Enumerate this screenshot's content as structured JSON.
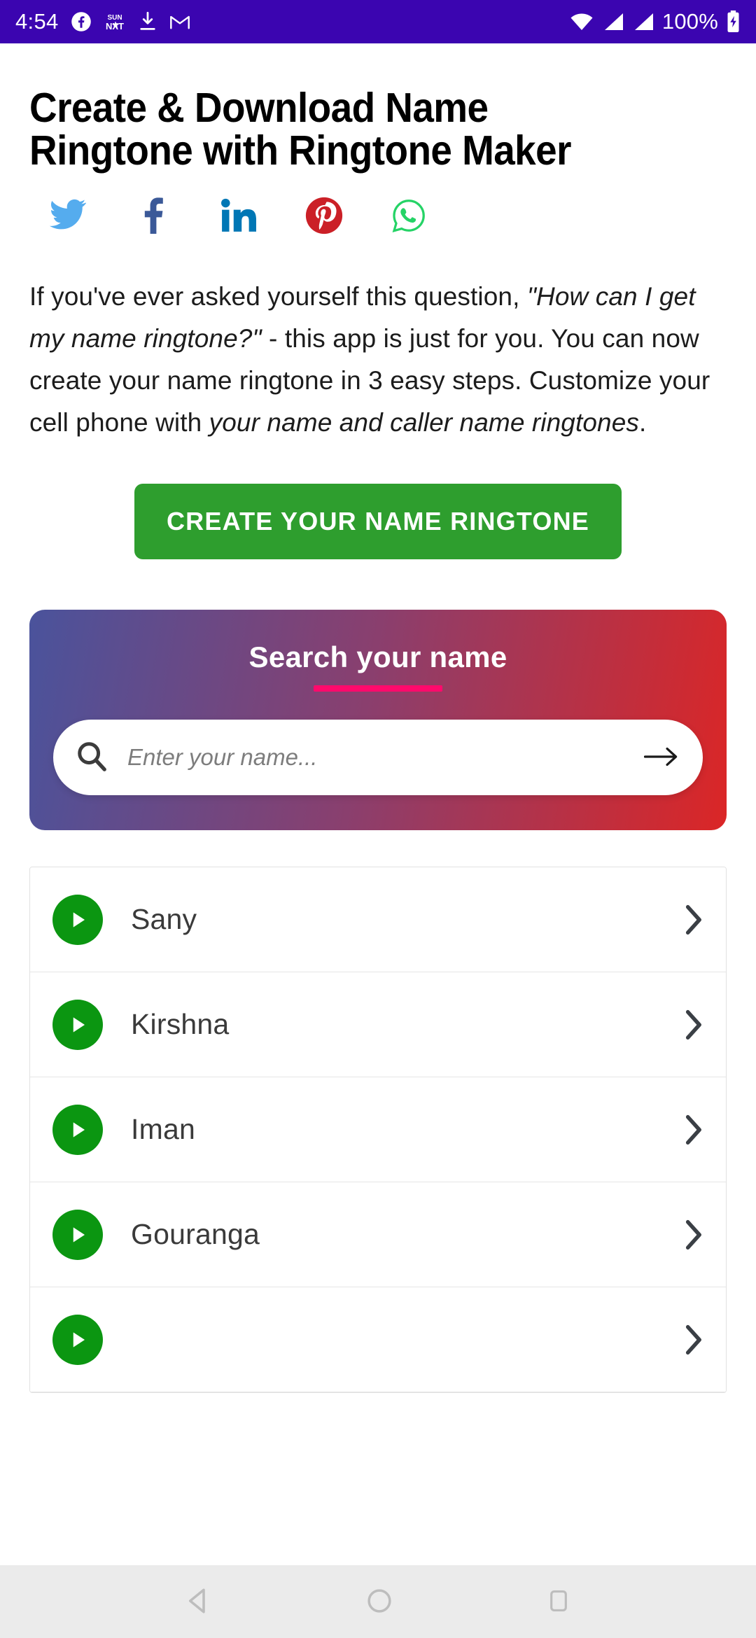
{
  "status_bar": {
    "time": "4:54",
    "battery_percent": "100%",
    "left_icons": [
      "facebook-icon",
      "sun-nxt-icon",
      "download-icon",
      "gmail-icon"
    ],
    "right_icons": [
      "wifi-icon",
      "signal-icon",
      "signal-icon",
      "battery-charging-icon"
    ],
    "background_color": "#3B05B0"
  },
  "article": {
    "title_line1": "Create & Download Name",
    "title_line2": "Ringtone with Ringtone Maker",
    "paragraph": {
      "part1": "If you've ever asked yourself this question, ",
      "quote": "\"How can I get my name ringtone?\"",
      "part2": " - this app is just for you. You can now create your name ringtone in 3 easy steps. Customize your cell phone with ",
      "emphasis": "your name and caller name ringtones",
      "part3": "."
    }
  },
  "share": {
    "items": [
      {
        "name": "twitter",
        "icon": "twitter-icon",
        "color": "#55ACEE"
      },
      {
        "name": "facebook",
        "icon": "facebook-icon",
        "color": "#3B5998"
      },
      {
        "name": "linkedin",
        "icon": "linkedin-icon",
        "color": "#0077B5"
      },
      {
        "name": "pinterest",
        "icon": "pinterest-icon",
        "color": "#CB2027"
      },
      {
        "name": "whatsapp",
        "icon": "whatsapp-icon",
        "color": "#25D366"
      }
    ]
  },
  "cta": {
    "label": "CREATE YOUR NAME RINGTONE",
    "color": "#2E9E2E"
  },
  "search_panel": {
    "title": "Search your name",
    "underline_color": "#FF0A6C",
    "gradient_from": "#4A539C",
    "gradient_to": "#DB2626",
    "input_value": "",
    "placeholder": "Enter your name...",
    "search_icon": "search-icon",
    "submit_icon": "arrow-right-icon"
  },
  "name_list": {
    "play_color": "#0B9611",
    "items": [
      {
        "name": "Sany"
      },
      {
        "name": "Kirshna"
      },
      {
        "name": "Iman"
      },
      {
        "name": "Gouranga"
      },
      {
        "name": ""
      }
    ]
  },
  "nav_bar": {
    "buttons": [
      "back-button",
      "home-button",
      "recents-button"
    ]
  }
}
